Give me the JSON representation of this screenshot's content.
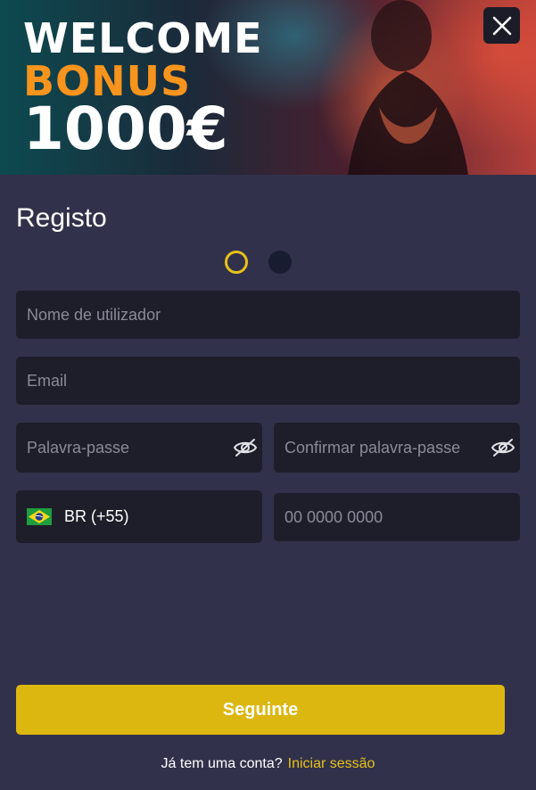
{
  "banner": {
    "line1": "WELCOME",
    "line2": "BONUS",
    "line3": "1000€"
  },
  "modal": {
    "title": "Registo",
    "steps_total": 2,
    "step_current": 1
  },
  "form": {
    "username_placeholder": "Nome de utilizador",
    "email_placeholder": "Email",
    "password_placeholder": "Palavra-passe",
    "confirm_password_placeholder": "Confirmar palavra-passe",
    "country_code": "BR (+55)",
    "phone_placeholder": "00 0000 0000"
  },
  "actions": {
    "next_label": "Seguinte"
  },
  "footer": {
    "question": "Já tem uma conta?",
    "login_label": "Iniciar sessão"
  },
  "colors": {
    "background": "#32314b",
    "field": "#1e1e2a",
    "accent": "#dcb710",
    "bonus": "#f7941d"
  }
}
